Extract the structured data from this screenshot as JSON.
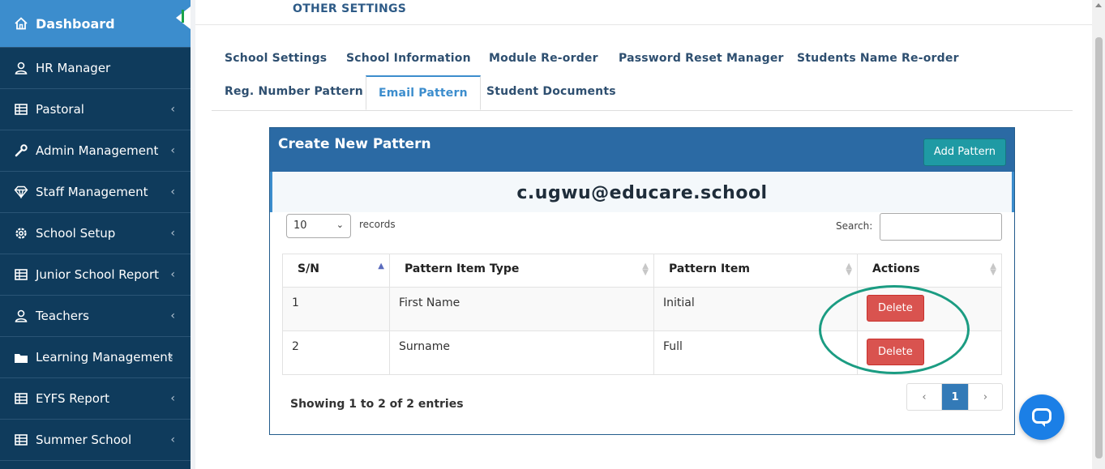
{
  "sidebar": {
    "items": [
      {
        "label": "Dashboard",
        "icon": "home-icon",
        "active": true
      },
      {
        "label": "HR Manager",
        "icon": "users-icon"
      },
      {
        "label": "Pastoral",
        "icon": "table-icon"
      },
      {
        "label": "Admin Management",
        "icon": "wrench-icon"
      },
      {
        "label": "Staff Management",
        "icon": "diamond-icon"
      },
      {
        "label": "School Setup",
        "icon": "gear-icon"
      },
      {
        "label": "Junior School Report",
        "icon": "table-icon"
      },
      {
        "label": "Teachers",
        "icon": "users-icon"
      },
      {
        "label": "Learning Management",
        "icon": "folder-icon"
      },
      {
        "label": "EYFS Report",
        "icon": "table-icon"
      },
      {
        "label": "Summer School",
        "icon": "table-icon"
      }
    ]
  },
  "header": {
    "section_title": "OTHER SETTINGS"
  },
  "tabs": [
    {
      "label": "School Settings"
    },
    {
      "label": "School Information"
    },
    {
      "label": "Module Re-order"
    },
    {
      "label": "Password Reset Manager"
    },
    {
      "label": "Students Name Re-order"
    },
    {
      "label": "Reg. Number Pattern"
    },
    {
      "label": "Email Pattern",
      "active": true
    },
    {
      "label": "Student Documents"
    }
  ],
  "panel": {
    "title": "Create New Pattern",
    "add_label": "Add Pattern",
    "email_preview": "c.ugwu@educare.school"
  },
  "table_controls": {
    "page_length": "10",
    "length_label": "records",
    "search_label": "Search:",
    "search_value": ""
  },
  "table": {
    "columns": [
      "S/N",
      "Pattern Item Type",
      "Pattern Item",
      "Actions"
    ],
    "rows": [
      {
        "sn": "1",
        "type": "First Name",
        "item": "Initial",
        "action": "Delete"
      },
      {
        "sn": "2",
        "type": "Surname",
        "item": "Full",
        "action": "Delete"
      }
    ]
  },
  "footer": {
    "showing": "Showing 1 to 2 of 2 entries",
    "prev": "‹",
    "current_page": "1",
    "next": "›"
  },
  "colors": {
    "sidebar_bg": "#0f3b5c",
    "active_nav": "#3c8dcd",
    "panel_header": "#2b6aa4",
    "add_button": "#1f9aa4",
    "delete_button": "#d9534f",
    "highlight_ring": "#1b9c82",
    "chat_button": "#1b7fe6"
  }
}
